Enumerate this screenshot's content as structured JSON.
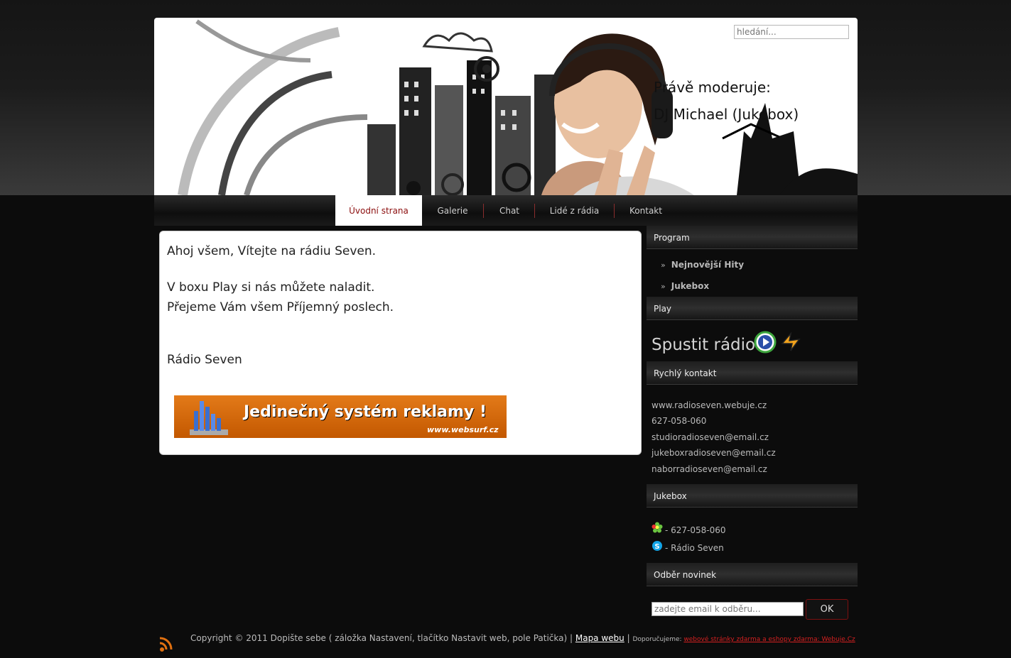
{
  "header": {
    "search_placeholder": "hledání...",
    "now_title": "Právě moderuje:",
    "now_dj": "DJ Michael (Jukebox)"
  },
  "menu": {
    "items": [
      {
        "label": "Úvodní strana",
        "active": true
      },
      {
        "label": "Galerie"
      },
      {
        "label": "Chat"
      },
      {
        "label": "Lidé z rádia"
      },
      {
        "label": "Kontakt"
      }
    ]
  },
  "content": {
    "greeting": "Ahoj všem, Vítejte na rádiu Seven.",
    "line1": "V boxu Play si nás můžete naladit.",
    "line2": "Přejeme Vám všem Příjemný poslech.",
    "signature": "Rádio Seven",
    "banner_text": "Jedinečný systém reklamy !",
    "banner_url": "www.websurf.cz"
  },
  "sidebar": {
    "program": {
      "title": "Program",
      "links": [
        "Nejnovější Hity",
        "Jukebox"
      ]
    },
    "play": {
      "title": "Play",
      "label": "Spustit rádio:"
    },
    "contact": {
      "title": "Rychlý kontakt",
      "lines": [
        "www.radioseven.webuje.cz",
        "627-058-060",
        "studioradioseven@email.cz",
        "jukeboxradioseven@email.cz",
        "naborradioseven@email.cz"
      ]
    },
    "jukebox": {
      "title": "Jukebox",
      "icq": "- 627-058-060",
      "skype": "- Rádio Seven"
    },
    "newsletter": {
      "title": "Odběr novinek",
      "placeholder": "zadejte email k odběru...",
      "ok": "OK"
    }
  },
  "footer": {
    "copyright": "Copyright © 2011 Dopište sebe ( záložka Nastavení, tlačítko Nastavit web, pole Patička) | ",
    "sitemap": "Mapa webu",
    "sep": " | ",
    "recommend": "Doporučujeme: ",
    "promo": "webové stránky zdarma a eshopy zdarma: Webuje.Cz"
  },
  "colors": {
    "accent_red": "#8b0d0d",
    "banner_orange": "#d96a10",
    "background": "#0c0c0c"
  }
}
